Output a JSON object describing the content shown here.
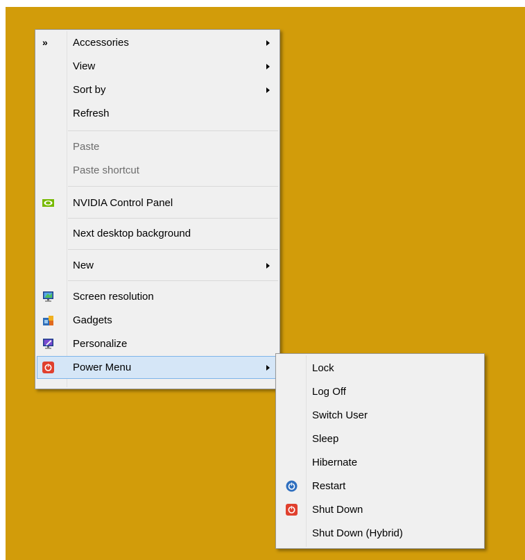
{
  "context_menu": {
    "items": [
      {
        "label": "Accessories",
        "icon": "chevron-double-right-icon",
        "submenu": true
      },
      {
        "label": "View",
        "submenu": true
      },
      {
        "label": "Sort by",
        "submenu": true
      },
      {
        "label": "Refresh"
      },
      {
        "label": "Paste",
        "disabled": true
      },
      {
        "label": "Paste shortcut",
        "disabled": true
      },
      {
        "label": "NVIDIA Control Panel",
        "icon": "nvidia-icon"
      },
      {
        "label": "Next desktop background"
      },
      {
        "label": "New",
        "submenu": true
      },
      {
        "label": "Screen resolution",
        "icon": "monitor-icon"
      },
      {
        "label": "Gadgets",
        "icon": "gadgets-icon"
      },
      {
        "label": "Personalize",
        "icon": "personalize-icon"
      },
      {
        "label": "Power Menu",
        "icon": "power-icon",
        "submenu": true,
        "highlighted": true
      }
    ],
    "chevron_glyph": "»"
  },
  "power_submenu": {
    "items": [
      {
        "label": "Lock"
      },
      {
        "label": "Log Off"
      },
      {
        "label": "Switch User"
      },
      {
        "label": "Sleep"
      },
      {
        "label": "Hibernate"
      },
      {
        "label": "Restart",
        "icon": "restart-icon"
      },
      {
        "label": "Shut Down",
        "icon": "shutdown-icon"
      },
      {
        "label": "Shut Down (Hybrid)"
      }
    ]
  },
  "colors": {
    "desktop": "#d29c0a",
    "menu_bg": "#f0f0f0",
    "highlight_bg": "#d5e6f7",
    "highlight_border": "#7eb4ea",
    "power_red": "#e0402e",
    "restart_blue": "#2f6fbf",
    "nvidia_green": "#76b900"
  }
}
